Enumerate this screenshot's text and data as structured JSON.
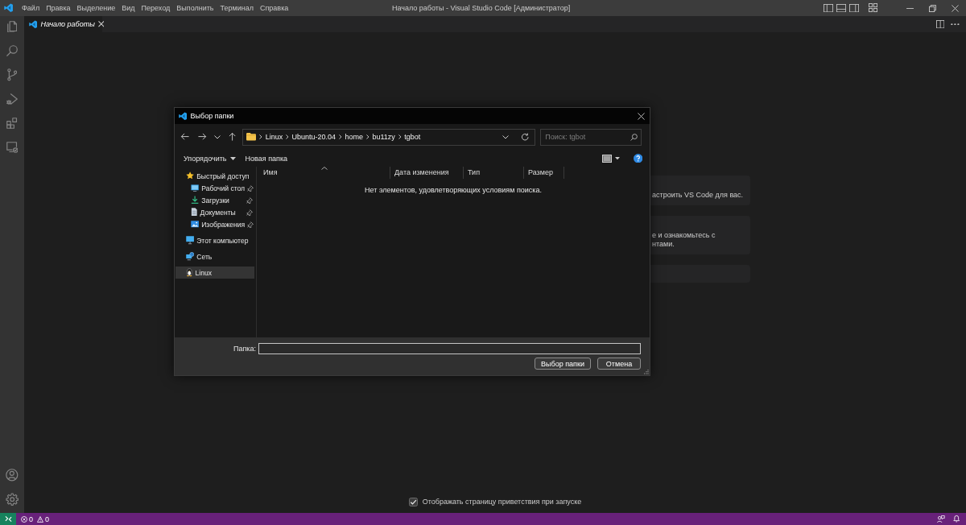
{
  "title_bar": {
    "menu": [
      "Файл",
      "Правка",
      "Выделение",
      "Вид",
      "Переход",
      "Выполнить",
      "Терминал",
      "Справка"
    ],
    "title": "Начало работы - Visual Studio Code [Администратор]"
  },
  "tabs": [
    {
      "label": "Начало работы",
      "selected": true,
      "preview": true
    }
  ],
  "welcome": {
    "cards": [
      {
        "kind": "text",
        "lines": [
          "астроить VS Code для вас."
        ]
      },
      {
        "kind": "text",
        "lines": [
          "е и ознакомьтесь с",
          "нтами."
        ]
      },
      {
        "kind": "blank"
      }
    ],
    "show_on_startup": {
      "label": "Отображать страницу приветствия при запуске",
      "checked": true
    }
  },
  "dialog": {
    "title": "Выбор папки",
    "path": [
      "Linux",
      "Ubuntu-20.04",
      "home",
      "bu11zy",
      "tgbot"
    ],
    "search": {
      "placeholder": "Поиск: tgbot"
    },
    "commands": [
      {
        "label": "Упорядочить",
        "kind": "menu"
      },
      {
        "label": "Новая папка",
        "kind": "plain"
      }
    ],
    "navigation": [
      {
        "label": "Быстрый доступ",
        "selected": false,
        "children": [
          {
            "label": "Рабочий стол",
            "pinned": true,
            "selected": false
          },
          {
            "label": "Загрузки",
            "pinned": true,
            "selected": false
          },
          {
            "label": "Документы",
            "pinned": true,
            "selected": false
          },
          {
            "label": "Изображения",
            "pinned": true,
            "selected": false
          }
        ]
      },
      {
        "label": "Этот компьютер",
        "selected": false
      },
      {
        "label": "Сеть",
        "selected": false
      },
      {
        "label": "Linux",
        "selected": true
      }
    ],
    "columns": [
      {
        "label": "Имя",
        "sorted": true
      },
      {
        "label": "Дата изменения",
        "sorted": false
      },
      {
        "label": "Тип",
        "sorted": false
      },
      {
        "label": "Размер",
        "sorted": false
      }
    ],
    "empty_message": "Нет элементов, удовлетворяющих условиям поиска.",
    "folder_field": {
      "label": "Папка:"
    },
    "buttons": [
      "Выбор папки",
      "Отмена"
    ]
  },
  "status_bar": {
    "problems": [
      {
        "kind": "error",
        "count": "0"
      },
      {
        "kind": "warning",
        "count": "0"
      }
    ]
  }
}
